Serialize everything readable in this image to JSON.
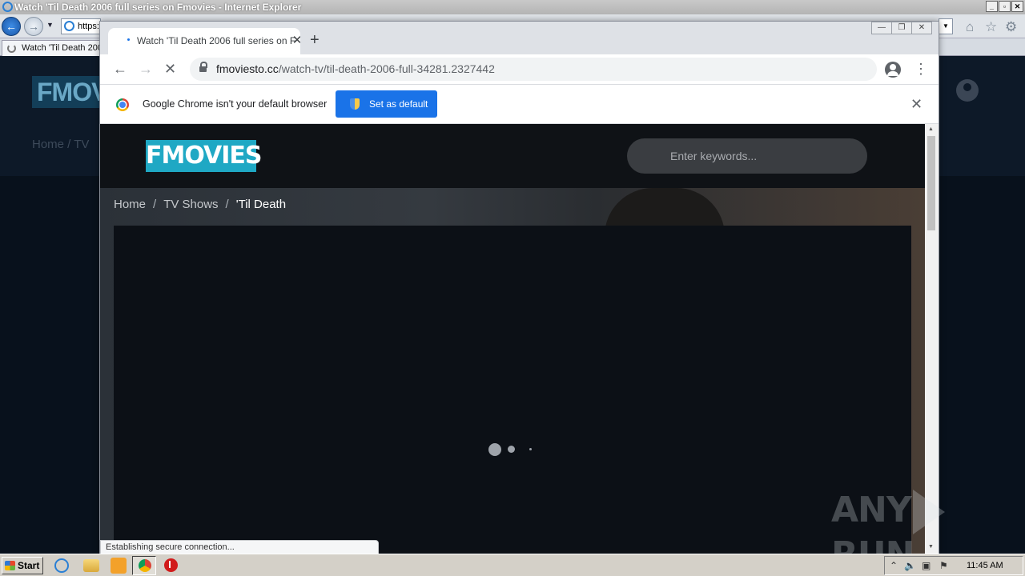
{
  "ie": {
    "title": "Watch 'Til Death 2006 full series on Fmovies - Internet Explorer",
    "address_fragment": "https:",
    "tab_label": "Watch 'Til Death 2006 ...",
    "bg_logo": "FMOVIES",
    "bg_crumb": "Home  /  TV"
  },
  "chrome": {
    "tab_title": "Watch 'Til Death 2006 full series on F",
    "url_host": "fmoviesto.cc",
    "url_path": "/watch-tv/til-death-2006-full-34281.2327442",
    "infobar_text": "Google Chrome isn't your default browser",
    "set_default_label": "Set as default",
    "status_text": "Establishing secure connection..."
  },
  "site": {
    "logo": "FMOVIES",
    "search_placeholder": "Enter keywords...",
    "breadcrumb": [
      "Home",
      "TV Shows",
      "'Til Death"
    ]
  },
  "watermark": {
    "left": "ANY",
    "right": "RUN"
  },
  "taskbar": {
    "start_label": "Start",
    "clock": "11:45 AM"
  },
  "icons": {
    "back": "back-arrow-icon",
    "forward": "forward-arrow-icon",
    "stop": "stop-x-icon",
    "lock": "lock-icon",
    "star": "star-icon",
    "profile": "profile-icon",
    "menu": "kebab-menu-icon"
  },
  "colors": {
    "logo_bg": "#1fa8c4",
    "set_default_bg": "#1a73e8",
    "page_bg": "#0b1018"
  }
}
